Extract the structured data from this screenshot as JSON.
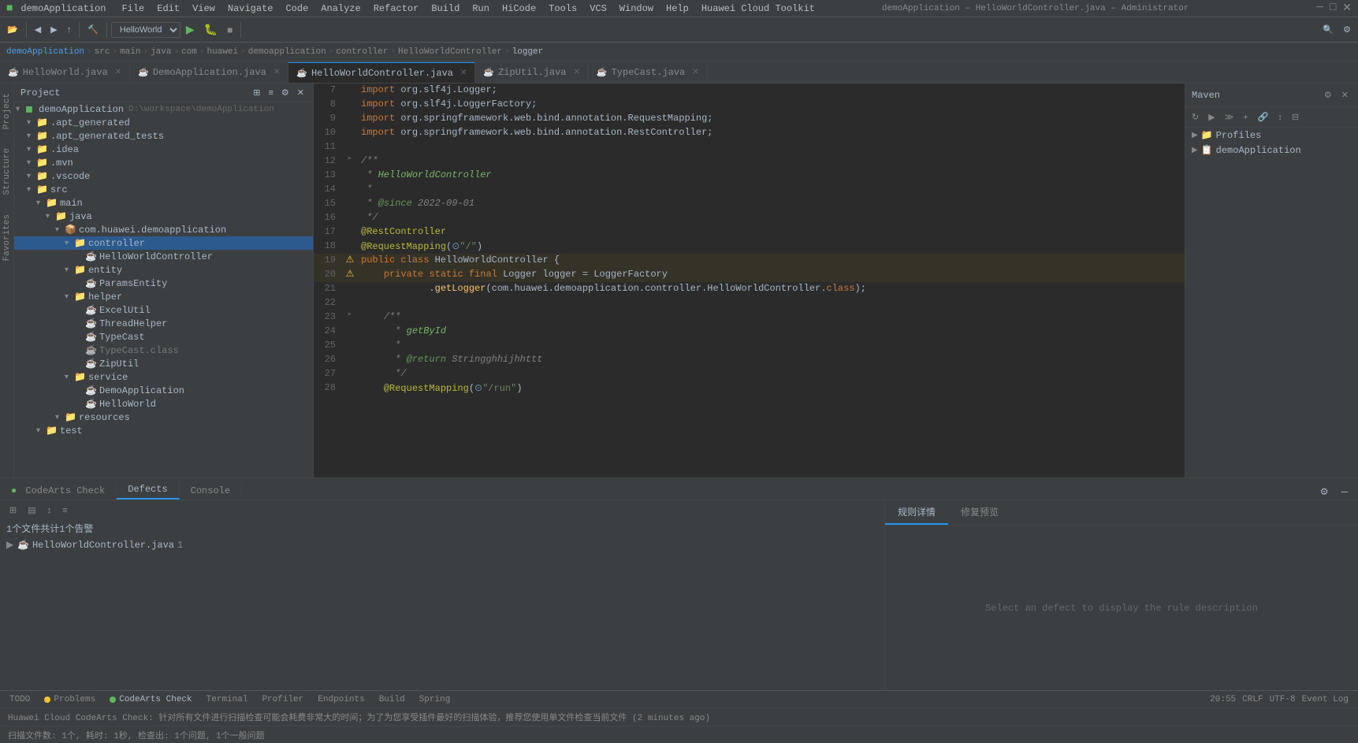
{
  "window": {
    "title": "demoApplication – HelloWorldController.java – Administrator",
    "appTitle": "demoApplication"
  },
  "menuBar": {
    "items": [
      "File",
      "Edit",
      "View",
      "Navigate",
      "Code",
      "Analyze",
      "Refactor",
      "Build",
      "Run",
      "HiCode",
      "Tools",
      "VCS",
      "Window",
      "Help",
      "Huawei Cloud Toolkit"
    ]
  },
  "breadcrumb": {
    "parts": [
      "demoApplication",
      "src",
      "main",
      "java",
      "com",
      "huawei",
      "demoapplication",
      "controller",
      "HelloWorldController",
      "logger"
    ]
  },
  "fileTabs": [
    {
      "name": "HelloWorld.java",
      "active": false,
      "type": "java"
    },
    {
      "name": "DemoApplication.java",
      "active": false,
      "type": "java"
    },
    {
      "name": "HelloWorldController.java",
      "active": true,
      "type": "java"
    },
    {
      "name": "ZipUtil.java",
      "active": false,
      "type": "java"
    },
    {
      "name": "TypeCast.java",
      "active": false,
      "type": "java"
    }
  ],
  "projectTree": {
    "title": "Project",
    "items": [
      {
        "level": 0,
        "arrow": "▾",
        "icon": "📁",
        "label": "demoApplication",
        "path": "D:\\workspace\\demoApplication",
        "type": "root"
      },
      {
        "level": 1,
        "arrow": "▾",
        "icon": "📁",
        "label": ".apt_generated",
        "type": "folder"
      },
      {
        "level": 1,
        "arrow": "▾",
        "icon": "📁",
        "label": ".apt_generated_tests",
        "type": "folder"
      },
      {
        "level": 1,
        "arrow": "▾",
        "icon": "📁",
        "label": ".idea",
        "type": "folder"
      },
      {
        "level": 1,
        "arrow": "▾",
        "icon": "📁",
        "label": ".mvn",
        "type": "folder"
      },
      {
        "level": 1,
        "arrow": "▾",
        "icon": "📁",
        "label": ".vscode",
        "type": "folder"
      },
      {
        "level": 1,
        "arrow": "▾",
        "icon": "📁",
        "label": "src",
        "type": "folder"
      },
      {
        "level": 2,
        "arrow": "▾",
        "icon": "📁",
        "label": "main",
        "type": "folder"
      },
      {
        "level": 3,
        "arrow": "▾",
        "icon": "📁",
        "label": "java",
        "type": "folder"
      },
      {
        "level": 4,
        "arrow": "▾",
        "icon": "📁",
        "label": "com.huawei.demoapplication",
        "type": "package"
      },
      {
        "level": 5,
        "arrow": "▾",
        "icon": "📁",
        "label": "controller",
        "type": "folder",
        "selected": true
      },
      {
        "level": 6,
        "arrow": " ",
        "icon": "☕",
        "label": "HelloWorldController",
        "type": "java"
      },
      {
        "level": 5,
        "arrow": "▾",
        "icon": "📁",
        "label": "entity",
        "type": "folder"
      },
      {
        "level": 6,
        "arrow": " ",
        "icon": "☕",
        "label": "ParamsEntity",
        "type": "java"
      },
      {
        "level": 5,
        "arrow": "▾",
        "icon": "📁",
        "label": "helper",
        "type": "folder"
      },
      {
        "level": 6,
        "arrow": " ",
        "icon": "☕",
        "label": "ExcelUtil",
        "type": "java"
      },
      {
        "level": 6,
        "arrow": " ",
        "icon": "☕",
        "label": "ThreadHelper",
        "type": "java"
      },
      {
        "level": 6,
        "arrow": " ",
        "icon": "☕",
        "label": "TypeCast",
        "type": "java"
      },
      {
        "level": 6,
        "arrow": " ",
        "icon": "☕",
        "label": "TypeCast.class",
        "type": "class"
      },
      {
        "level": 6,
        "arrow": " ",
        "icon": "☕",
        "label": "ZipUtil",
        "type": "java"
      },
      {
        "level": 5,
        "arrow": "▾",
        "icon": "📁",
        "label": "service",
        "type": "folder"
      },
      {
        "level": 6,
        "arrow": " ",
        "icon": "☕",
        "label": "DemoApplication",
        "type": "java"
      },
      {
        "level": 6,
        "arrow": " ",
        "icon": "☕",
        "label": "HelloWorld",
        "type": "java"
      },
      {
        "level": 4,
        "arrow": "▾",
        "icon": "📁",
        "label": "resources",
        "type": "folder"
      },
      {
        "level": 3,
        "arrow": "▾",
        "icon": "📁",
        "label": "test",
        "type": "folder"
      }
    ]
  },
  "codeEditor": {
    "lines": [
      {
        "num": "7",
        "gutter": "",
        "content": "import org.slf4j.Logger;",
        "html": "<span class='kw'>import</span> <span class='pkg'>org.slf4j.Logger</span>;"
      },
      {
        "num": "8",
        "gutter": "",
        "content": "import org.slf4j.LoggerFactory;",
        "html": "<span class='kw'>import</span> <span class='pkg'>org.slf4j.LoggerFactory</span>;"
      },
      {
        "num": "9",
        "gutter": "",
        "content": "import org.springframework.web.bind.annotation.RequestMapping;",
        "html": "<span class='kw'>import</span> <span class='pkg'>org.springframework.web.bind.annotation.RequestMapping</span>;"
      },
      {
        "num": "10",
        "gutter": "",
        "content": "import org.springframework.web.bind.annotation.RestController;",
        "html": "<span class='kw'>import</span> <span class='pkg'>org.springframework.web.bind.annotation.RestController</span>;"
      },
      {
        "num": "11",
        "gutter": "",
        "content": "",
        "html": ""
      },
      {
        "num": "12",
        "gutter": "fold",
        "content": "/**",
        "html": "<span class='cmt'>/**</span>"
      },
      {
        "num": "13",
        "gutter": "",
        "content": " * HelloWorldController",
        "html": "<span class='cmt'> * </span><span class='javadoc-text'>HelloWorldController</span>"
      },
      {
        "num": "14",
        "gutter": "",
        "content": " *",
        "html": "<span class='cmt'> *</span>"
      },
      {
        "num": "15",
        "gutter": "",
        "content": " * @since 2022-09-01",
        "html": "<span class='cmt'> * </span><span class='javadoc-tag'>@since</span><span class='cmt'> 2022-09-01</span>"
      },
      {
        "num": "16",
        "gutter": "",
        "content": " */",
        "html": "<span class='cmt'> */</span>"
      },
      {
        "num": "17",
        "gutter": "",
        "content": "@RestController",
        "html": "<span class='annotation'>@RestController</span>"
      },
      {
        "num": "18",
        "gutter": "",
        "content": "@RequestMapping(\"/\")",
        "html": "<span class='annotation'>@RequestMapping</span>(<span class='str'>\"/\"</span>)"
      },
      {
        "num": "19",
        "gutter": "warn",
        "content": "public class HelloWorldController {",
        "html": "<span class='kw'>public</span> <span class='kw'>class</span> <span class='cls'>HelloWorldController</span> {"
      },
      {
        "num": "20",
        "gutter": "warn",
        "content": "    private static final Logger logger = LoggerFactory",
        "html": "    <span class='kw'>private</span> <span class='kw'>static</span> <span class='kw'>final</span> <span class='type'>Logger</span> <span class='var'>logger</span> = <span class='cls'>LoggerFactory</span>"
      },
      {
        "num": "21",
        "gutter": "",
        "content": "            .getLogger(com.huawei.demoapplication.controller.HelloWorldController.class);",
        "html": "            .<span class='method'>getLogger</span>(<span class='pkg'>com.huawei.demoapplication.controller.HelloWorldController</span>.<span class='kw'>class</span>);"
      },
      {
        "num": "22",
        "gutter": "",
        "content": "",
        "html": ""
      },
      {
        "num": "23",
        "gutter": "fold",
        "content": "    /**",
        "html": "    <span class='cmt'>/**</span>"
      },
      {
        "num": "24",
        "gutter": "",
        "content": "     * getById",
        "html": "    <span class='cmt'> * </span><span class='javadoc-text'>getById</span>"
      },
      {
        "num": "25",
        "gutter": "",
        "content": "     *",
        "html": "    <span class='cmt'> *</span>"
      },
      {
        "num": "26",
        "gutter": "",
        "content": "     * @return Stringghhijhhttt",
        "html": "    <span class='cmt'> * </span><span class='javadoc-tag'>@return</span><span class='cmt'> Stringghhijhhhttt</span>"
      },
      {
        "num": "27",
        "gutter": "",
        "content": "     */",
        "html": "    <span class='cmt'> */</span>"
      },
      {
        "num": "28",
        "gutter": "",
        "content": "    @RequestMapping(\"/run\")",
        "html": "    <span class='annotation'>@RequestMapping</span>(<span class='str'>\"/run\"</span>)"
      }
    ]
  },
  "mavenPanel": {
    "title": "Maven",
    "items": [
      {
        "label": "Profiles",
        "type": "folder",
        "level": 0
      },
      {
        "label": "demoApplication",
        "type": "folder",
        "level": 0
      }
    ]
  },
  "bottomPanel": {
    "tabs": [
      "CodeArts Check",
      "Defects",
      "Console"
    ],
    "activeTab": "Defects",
    "defectSummary": "1个文件共计1个告警",
    "defectFiles": [
      {
        "name": "HelloWorldController.java",
        "count": 1
      }
    ],
    "rightTabs": [
      "规则详情",
      "修复预览"
    ],
    "activeRightTab": "规则详情",
    "rightPlaceholder": "Select an defect to display the rule description"
  },
  "statusTabs": {
    "items": [
      "TODO",
      "Problems",
      "CodeArts Check",
      "Terminal",
      "Profiler",
      "Endpoints",
      "Build",
      "Spring"
    ],
    "activeItem": "CodeArts Check"
  },
  "statusBar": {
    "scanInfo": "扫描文件数: 1个, 耗时: 1秒, 检查出: 1个问题, 1个一般问题",
    "position": "20:55",
    "encoding": "CRLF",
    "charSet": "UTF-8",
    "eventLog": "Event Log"
  },
  "notification": {
    "text": "Huawei Cloud CodeArts Check: 针对所有文件进行扫描检查可能会耗费非常大的时间；为了为您享受插件最好的扫描体验，推荐您使用单文件检查当前文件 (2 minutes ago)"
  }
}
